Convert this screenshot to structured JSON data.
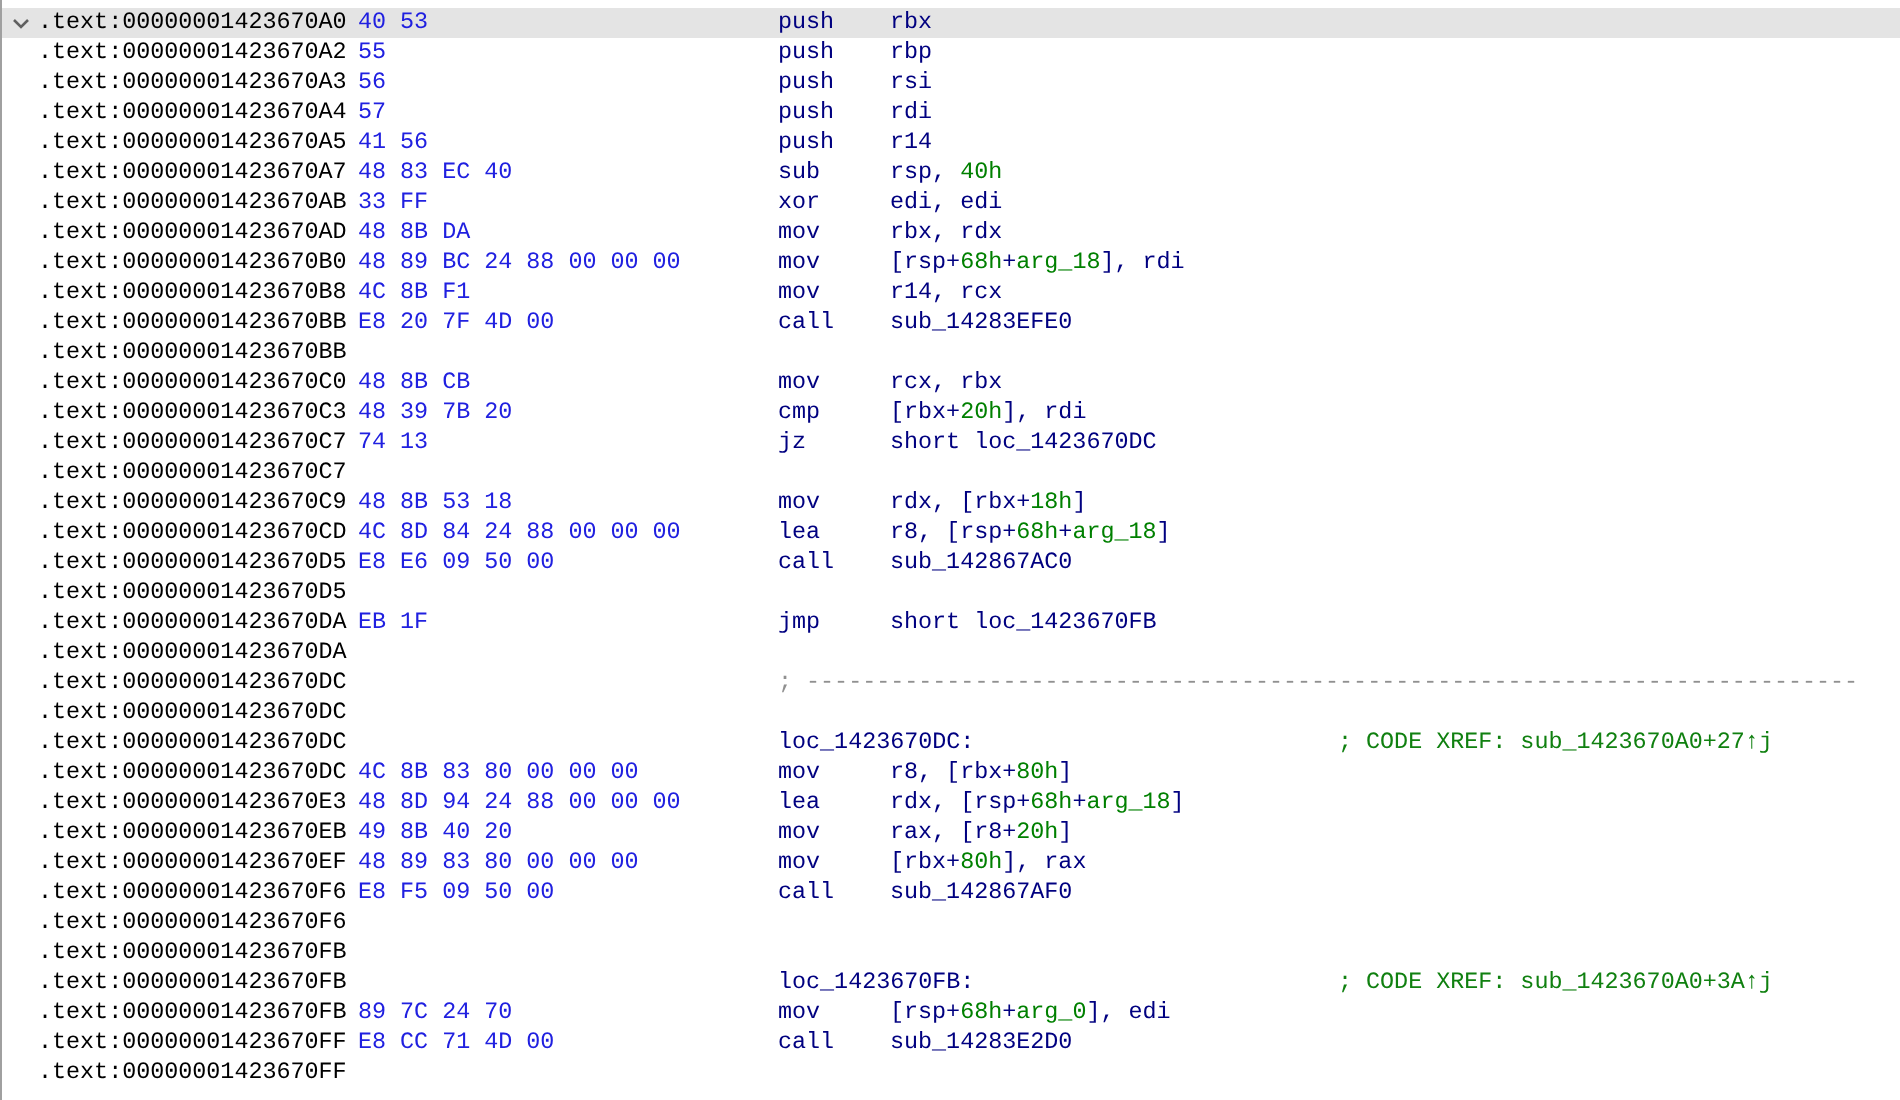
{
  "listing": {
    "rows": [
      {
        "kind": "function_start",
        "selected": true,
        "address": ".text:00000001423670A0",
        "bytes": "40 53",
        "mnemonic": "push",
        "operands": [
          {
            "text": "rbx",
            "kind": "reg"
          }
        ]
      },
      {
        "kind": "instruction",
        "selected": false,
        "address": ".text:00000001423670A2",
        "bytes": "55",
        "mnemonic": "push",
        "operands": [
          {
            "text": "rbp",
            "kind": "reg"
          }
        ]
      },
      {
        "kind": "instruction",
        "selected": false,
        "address": ".text:00000001423670A3",
        "bytes": "56",
        "mnemonic": "push",
        "operands": [
          {
            "text": "rsi",
            "kind": "reg"
          }
        ]
      },
      {
        "kind": "instruction",
        "selected": false,
        "address": ".text:00000001423670A4",
        "bytes": "57",
        "mnemonic": "push",
        "operands": [
          {
            "text": "rdi",
            "kind": "reg"
          }
        ]
      },
      {
        "kind": "instruction",
        "selected": false,
        "address": ".text:00000001423670A5",
        "bytes": "41 56",
        "mnemonic": "push",
        "operands": [
          {
            "text": "r14",
            "kind": "reg"
          }
        ]
      },
      {
        "kind": "instruction",
        "selected": false,
        "address": ".text:00000001423670A7",
        "bytes": "48 83 EC 40",
        "mnemonic": "sub",
        "operands": [
          {
            "text": "rsp, ",
            "kind": "reg"
          },
          {
            "text": "40h",
            "kind": "num"
          }
        ]
      },
      {
        "kind": "instruction",
        "selected": false,
        "address": ".text:00000001423670AB",
        "bytes": "33 FF",
        "mnemonic": "xor",
        "operands": [
          {
            "text": "edi, edi",
            "kind": "reg"
          }
        ]
      },
      {
        "kind": "instruction",
        "selected": false,
        "address": ".text:00000001423670AD",
        "bytes": "48 8B DA",
        "mnemonic": "mov",
        "operands": [
          {
            "text": "rbx, rdx",
            "kind": "reg"
          }
        ]
      },
      {
        "kind": "instruction",
        "selected": false,
        "address": ".text:00000001423670B0",
        "bytes": "48 89 BC 24 88 00 00 00",
        "mnemonic": "mov",
        "operands": [
          {
            "text": "[rsp+",
            "kind": "reg"
          },
          {
            "text": "68h",
            "kind": "num"
          },
          {
            "text": "+",
            "kind": "reg"
          },
          {
            "text": "arg_18",
            "kind": "num"
          },
          {
            "text": "], rdi",
            "kind": "reg"
          }
        ]
      },
      {
        "kind": "instruction",
        "selected": false,
        "address": ".text:00000001423670B8",
        "bytes": "4C 8B F1",
        "mnemonic": "mov",
        "operands": [
          {
            "text": "r14, rcx",
            "kind": "reg"
          }
        ]
      },
      {
        "kind": "instruction",
        "selected": false,
        "address": ".text:00000001423670BB",
        "bytes": "E8 20 7F 4D 00",
        "mnemonic": "call",
        "operands": [
          {
            "text": "sub_14283EFE0",
            "kind": "reg"
          }
        ]
      },
      {
        "kind": "blank",
        "selected": false,
        "address": ".text:00000001423670BB"
      },
      {
        "kind": "instruction",
        "selected": false,
        "address": ".text:00000001423670C0",
        "bytes": "48 8B CB",
        "mnemonic": "mov",
        "operands": [
          {
            "text": "rcx, rbx",
            "kind": "reg"
          }
        ]
      },
      {
        "kind": "instruction",
        "selected": false,
        "address": ".text:00000001423670C3",
        "bytes": "48 39 7B 20",
        "mnemonic": "cmp",
        "operands": [
          {
            "text": "[rbx+",
            "kind": "reg"
          },
          {
            "text": "20h",
            "kind": "num"
          },
          {
            "text": "], rdi",
            "kind": "reg"
          }
        ]
      },
      {
        "kind": "instruction",
        "selected": false,
        "address": ".text:00000001423670C7",
        "bytes": "74 13",
        "mnemonic": "jz",
        "operands": [
          {
            "text": "short loc_1423670DC",
            "kind": "reg"
          }
        ]
      },
      {
        "kind": "blank",
        "selected": false,
        "address": ".text:00000001423670C7"
      },
      {
        "kind": "instruction",
        "selected": false,
        "address": ".text:00000001423670C9",
        "bytes": "48 8B 53 18",
        "mnemonic": "mov",
        "operands": [
          {
            "text": "rdx, [rbx+",
            "kind": "reg"
          },
          {
            "text": "18h",
            "kind": "num"
          },
          {
            "text": "]",
            "kind": "reg"
          }
        ]
      },
      {
        "kind": "instruction",
        "selected": false,
        "address": ".text:00000001423670CD",
        "bytes": "4C 8D 84 24 88 00 00 00",
        "mnemonic": "lea",
        "operands": [
          {
            "text": "r8, [rsp+",
            "kind": "reg"
          },
          {
            "text": "68h",
            "kind": "num"
          },
          {
            "text": "+",
            "kind": "reg"
          },
          {
            "text": "arg_18",
            "kind": "num"
          },
          {
            "text": "]",
            "kind": "reg"
          }
        ]
      },
      {
        "kind": "instruction",
        "selected": false,
        "address": ".text:00000001423670D5",
        "bytes": "E8 E6 09 50 00",
        "mnemonic": "call",
        "operands": [
          {
            "text": "sub_142867AC0",
            "kind": "reg"
          }
        ]
      },
      {
        "kind": "blank",
        "selected": false,
        "address": ".text:00000001423670D5"
      },
      {
        "kind": "instruction",
        "selected": false,
        "address": ".text:00000001423670DA",
        "bytes": "EB 1F",
        "mnemonic": "jmp",
        "operands": [
          {
            "text": "short loc_1423670FB",
            "kind": "reg"
          }
        ]
      },
      {
        "kind": "blank",
        "selected": false,
        "address": ".text:00000001423670DA"
      },
      {
        "kind": "separator",
        "selected": false,
        "address": ".text:00000001423670DC",
        "text": "; ---------------------------------------------------------------------------"
      },
      {
        "kind": "blank",
        "selected": false,
        "address": ".text:00000001423670DC"
      },
      {
        "kind": "label",
        "selected": false,
        "address": ".text:00000001423670DC",
        "label": "loc_1423670DC:",
        "comment": "; CODE XREF: sub_1423670A0+27↑j"
      },
      {
        "kind": "instruction",
        "selected": false,
        "address": ".text:00000001423670DC",
        "bytes": "4C 8B 83 80 00 00 00",
        "mnemonic": "mov",
        "operands": [
          {
            "text": "r8, [rbx+",
            "kind": "reg"
          },
          {
            "text": "80h",
            "kind": "num"
          },
          {
            "text": "]",
            "kind": "reg"
          }
        ]
      },
      {
        "kind": "instruction",
        "selected": false,
        "address": ".text:00000001423670E3",
        "bytes": "48 8D 94 24 88 00 00 00",
        "mnemonic": "lea",
        "operands": [
          {
            "text": "rdx, [rsp+",
            "kind": "reg"
          },
          {
            "text": "68h",
            "kind": "num"
          },
          {
            "text": "+",
            "kind": "reg"
          },
          {
            "text": "arg_18",
            "kind": "num"
          },
          {
            "text": "]",
            "kind": "reg"
          }
        ]
      },
      {
        "kind": "instruction",
        "selected": false,
        "address": ".text:00000001423670EB",
        "bytes": "49 8B 40 20",
        "mnemonic": "mov",
        "operands": [
          {
            "text": "rax, [r8+",
            "kind": "reg"
          },
          {
            "text": "20h",
            "kind": "num"
          },
          {
            "text": "]",
            "kind": "reg"
          }
        ]
      },
      {
        "kind": "instruction",
        "selected": false,
        "address": ".text:00000001423670EF",
        "bytes": "48 89 83 80 00 00 00",
        "mnemonic": "mov",
        "operands": [
          {
            "text": "[rbx+",
            "kind": "reg"
          },
          {
            "text": "80h",
            "kind": "num"
          },
          {
            "text": "], rax",
            "kind": "reg"
          }
        ]
      },
      {
        "kind": "instruction",
        "selected": false,
        "address": ".text:00000001423670F6",
        "bytes": "E8 F5 09 50 00",
        "mnemonic": "call",
        "operands": [
          {
            "text": "sub_142867AF0",
            "kind": "reg"
          }
        ]
      },
      {
        "kind": "blank",
        "selected": false,
        "address": ".text:00000001423670F6"
      },
      {
        "kind": "blank",
        "selected": false,
        "address": ".text:00000001423670FB"
      },
      {
        "kind": "label",
        "selected": false,
        "address": ".text:00000001423670FB",
        "label": "loc_1423670FB:",
        "comment": "; CODE XREF: sub_1423670A0+3A↑j"
      },
      {
        "kind": "instruction",
        "selected": false,
        "address": ".text:00000001423670FB",
        "bytes": "89 7C 24 70",
        "mnemonic": "mov",
        "operands": [
          {
            "text": "[rsp+",
            "kind": "reg"
          },
          {
            "text": "68h",
            "kind": "num"
          },
          {
            "text": "+",
            "kind": "reg"
          },
          {
            "text": "arg_0",
            "kind": "num"
          },
          {
            "text": "], edi",
            "kind": "reg"
          }
        ]
      },
      {
        "kind": "instruction",
        "selected": false,
        "address": ".text:00000001423670FF",
        "bytes": "E8 CC 71 4D 00",
        "mnemonic": "call",
        "operands": [
          {
            "text": "sub_14283E2D0",
            "kind": "reg"
          }
        ]
      },
      {
        "kind": "blank",
        "selected": false,
        "address": ".text:00000001423670FF"
      }
    ]
  }
}
